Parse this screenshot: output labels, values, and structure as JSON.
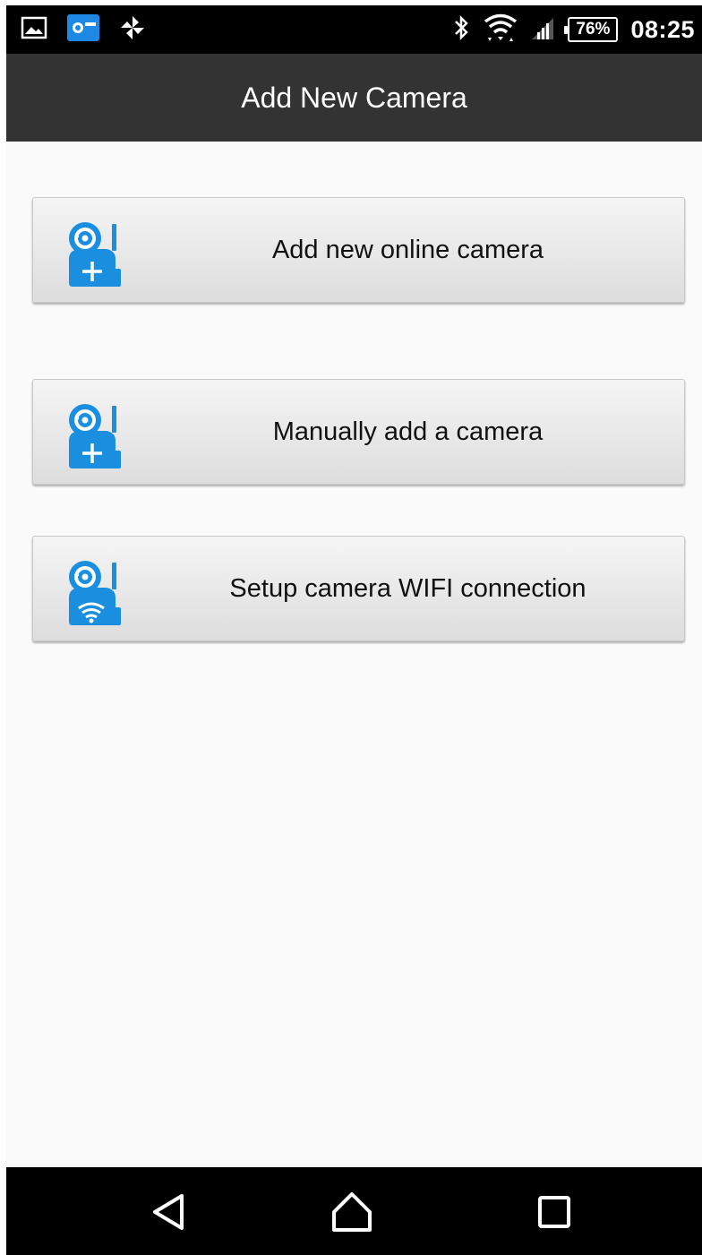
{
  "status_bar": {
    "left_icons": [
      "image-notification-icon",
      "camera-app-notification-icon",
      "pinwheel-notification-icon"
    ],
    "right_icons": [
      "bluetooth-icon",
      "wifi-icon",
      "cell-signal-icon"
    ],
    "battery": "76%",
    "time": "08:25"
  },
  "action_bar": {
    "title": "Add New Camera",
    "background": "#333333"
  },
  "options": [
    {
      "label": "Add new online camera",
      "icon": "camera-add-icon"
    },
    {
      "label": "Manually add a camera",
      "icon": "camera-add-icon"
    },
    {
      "label": "Setup camera WIFI connection",
      "icon": "camera-wifi-icon"
    }
  ],
  "accent_color": "#1a8fe0",
  "nav_bar": {
    "buttons": [
      "back-icon",
      "home-icon",
      "recents-icon"
    ]
  }
}
